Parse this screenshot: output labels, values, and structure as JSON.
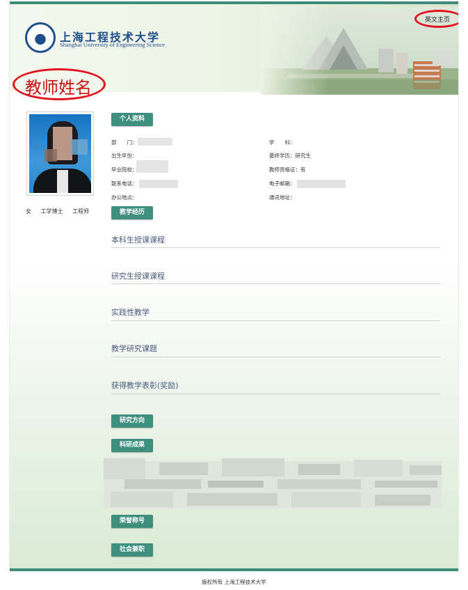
{
  "header": {
    "school_name_cn": "上海工程技术大学",
    "school_name_en": "Shanghai University of Engineering Science",
    "english_link": "英文主页"
  },
  "teacher": {
    "name": "教师姓名",
    "tags": [
      "女",
      "工学博士",
      "工程师"
    ]
  },
  "sections": {
    "profile": "个人资料",
    "teaching": "教学经历",
    "research_direction": "研究方向",
    "research_results": "科研成果",
    "honors": "荣誉称号",
    "social_positions": "社会兼职"
  },
  "profile": {
    "department_label": "部　　门：",
    "discipline_label": "学　　科：",
    "birth_label": "出生年份：",
    "education_label": "最终学历：",
    "education_value": "研究生",
    "graduate_label": "毕业院校：",
    "qualification_label": "教师资格证：",
    "qualification_value": "有",
    "phone_label": "联系电话：",
    "email_label": "电子邮箱：",
    "office_label": "办公地点：",
    "address_label": "通讯地址："
  },
  "teaching": {
    "items": [
      "本科生授课课程",
      "研究生授课课程",
      "实践性教学",
      "教学研究课题",
      "获得教学表彰(奖励)"
    ]
  },
  "footer": {
    "copyright": "版权所有 上海工程技术大学"
  },
  "colors": {
    "accent": "#3f8f7e",
    "annotation": "#e0131f",
    "name_text": "#cc1111",
    "logo_blue": "#1d4d8a"
  }
}
